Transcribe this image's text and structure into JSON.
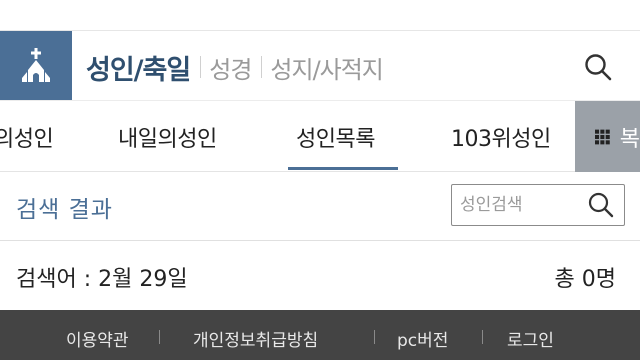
{
  "header": {
    "nav_active": "성인/축일",
    "nav_items": [
      "성경",
      "성지/사적지"
    ],
    "brand_color": "#4b6f96"
  },
  "tabs": {
    "items": [
      "의성인",
      "내일의성인",
      "성인목록",
      "103위성인"
    ],
    "more_label": "복"
  },
  "search": {
    "result_title": "검색 결과",
    "placeholder": "성인검색"
  },
  "result": {
    "keyword_label": "검색어 : 2월 29일",
    "total": "총 0명"
  },
  "footer": {
    "links": [
      "이용약관",
      "개인정보취급방침",
      "pc버전",
      "로그인"
    ]
  },
  "icons": {
    "logo": "church-icon",
    "search": "search-icon",
    "grid": "grid-icon"
  }
}
